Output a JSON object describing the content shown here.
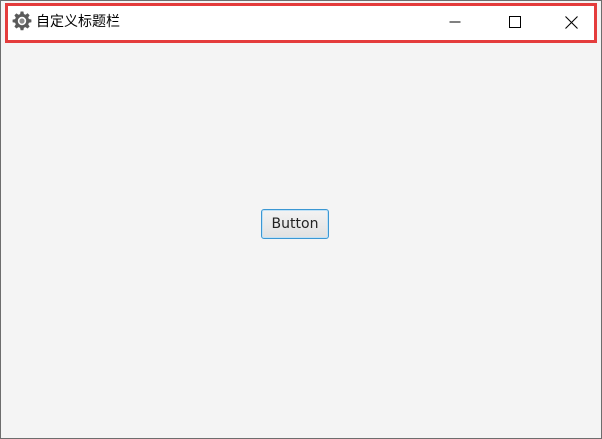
{
  "window": {
    "title": "自定义标题栏",
    "app_icon": "gear-icon",
    "controls": {
      "minimize_icon": "minimize-icon",
      "maximize_icon": "maximize-icon",
      "close_icon": "close-icon"
    }
  },
  "content": {
    "button_label": "Button"
  },
  "colors": {
    "titlebar_highlight": "#e43c3c",
    "content_background": "#f4f4f4",
    "button_focus": "#3b97d3"
  }
}
